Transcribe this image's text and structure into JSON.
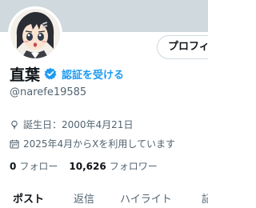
{
  "header": {
    "edit_profile_label": "プロフィ"
  },
  "profile": {
    "display_name": "直葉",
    "verify_label": "認証を受ける",
    "handle": "@narefe19585",
    "birth": "誕生日：2000年4月21日",
    "joined": "2025年4月からXを利用しています",
    "following_count": "0",
    "following_label": "フォロー",
    "followers_count": "10,626",
    "followers_label": "フォロワー"
  },
  "tabs": [
    {
      "label": "ポスト"
    },
    {
      "label": "返信"
    },
    {
      "label": "ハイライト"
    },
    {
      "label": "記"
    }
  ],
  "colors": {
    "accent": "#1d9bf0",
    "text_primary": "#0f1419",
    "text_secondary": "#536471",
    "banner": "#cfd9de",
    "border": "#cfd9de"
  },
  "icons": {
    "verify": "verified-badge-icon",
    "birth": "balloon-icon",
    "joined": "calendar-icon"
  }
}
